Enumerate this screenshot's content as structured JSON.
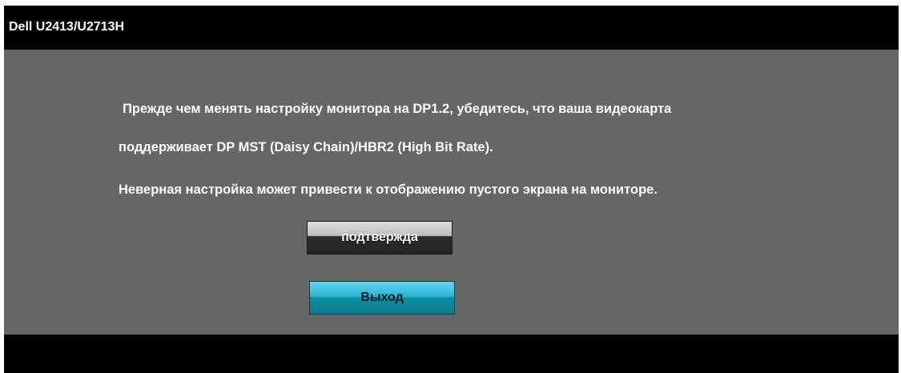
{
  "window": {
    "title": "Dell U2413/U2713H"
  },
  "message": {
    "line1": "Прежде чем менять настройку монитора на DP1.2, убедитесь, что ваша видеокарта",
    "line2": "поддерживает DP MST (Daisy Chain)/HBR2 (High Bit Rate).",
    "line3": "Неверная настройка может привести к отображению пустого экрана на мониторе."
  },
  "buttons": {
    "confirm_label": "подтвержда",
    "exit_label": "Выход"
  },
  "colors": {
    "title_bar": "#000000",
    "panel": "#666666",
    "text": "#ffffff",
    "exit_button": "#2bb6d5"
  }
}
